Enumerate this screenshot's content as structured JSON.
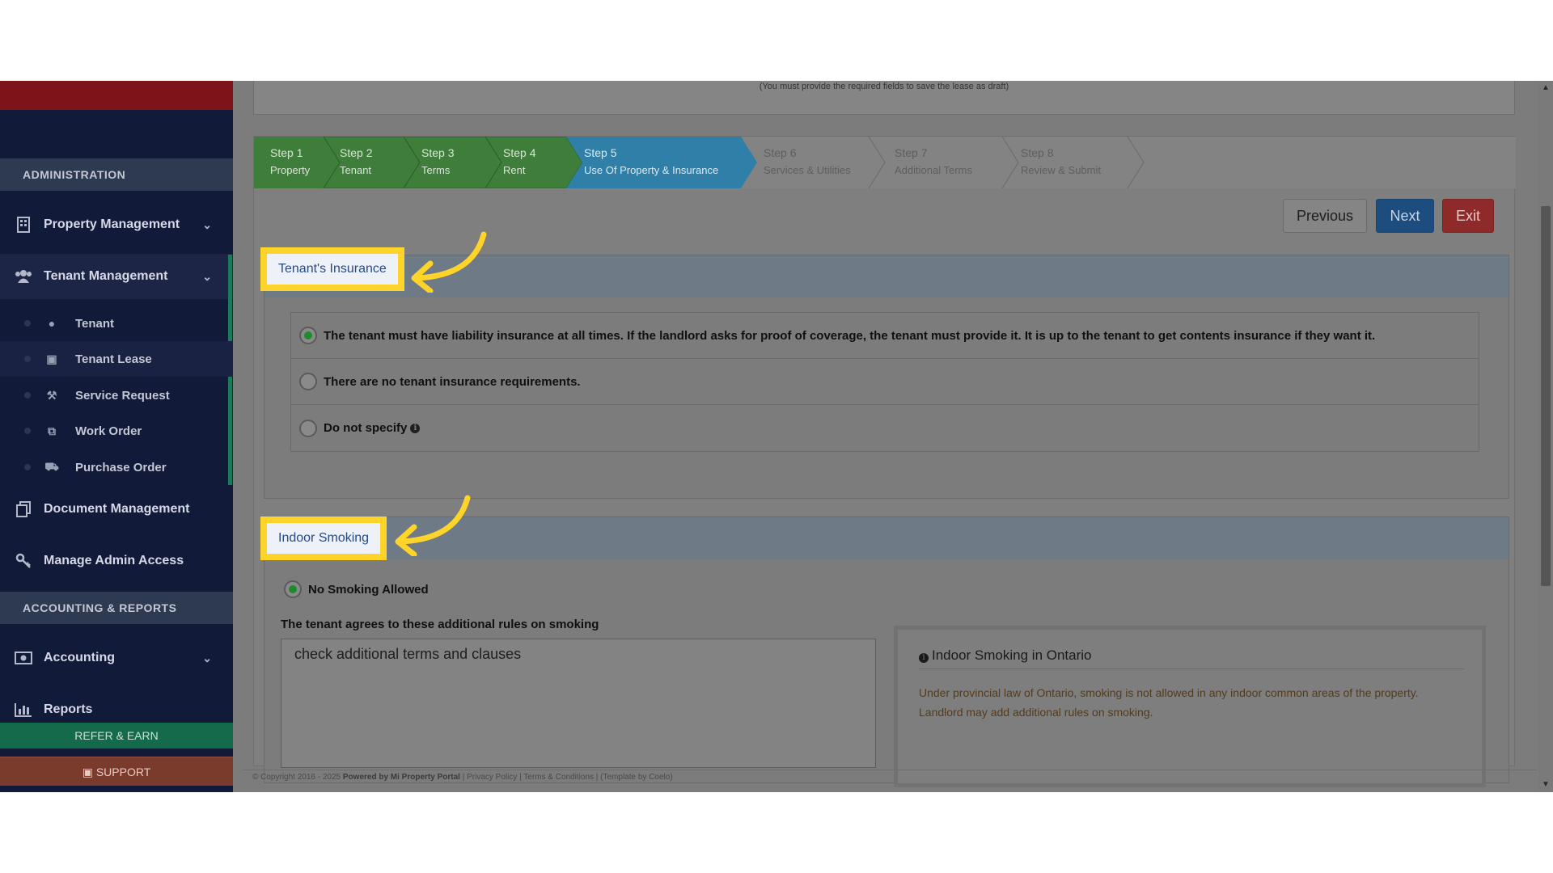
{
  "sidebar": {
    "section_admin": "ADMINISTRATION",
    "section_accounting": "ACCOUNTING & REPORTS",
    "items": {
      "property_management": "Property Management",
      "tenant_management": "Tenant Management",
      "document_management": "Document Management",
      "manage_admin_access": "Manage Admin Access",
      "accounting": "Accounting",
      "reports": "Reports"
    },
    "sub_items": [
      "Tenant",
      "Tenant Lease",
      "Service Request",
      "Work Order",
      "Purchase Order"
    ],
    "refer": "REFER & EARN",
    "support": "SUPPORT"
  },
  "top_note": "(You must provide the required fields to save the lease as draft)",
  "steps": [
    {
      "label": "Step 1",
      "name": "Property"
    },
    {
      "label": "Step 2",
      "name": "Tenant"
    },
    {
      "label": "Step 3",
      "name": "Terms"
    },
    {
      "label": "Step 4",
      "name": "Rent"
    },
    {
      "label": "Step 5",
      "name": "Use Of Property & Insurance"
    },
    {
      "label": "Step 6",
      "name": "Services & Utilities"
    },
    {
      "label": "Step 7",
      "name": "Additional Terms"
    },
    {
      "label": "Step 8",
      "name": "Review & Submit"
    }
  ],
  "buttons": {
    "previous": "Previous",
    "next": "Next",
    "exit": "Exit"
  },
  "insurance": {
    "title": "Tenant's Insurance",
    "options": [
      "The tenant must have liability insurance at all times. If the landlord asks for proof of coverage, the tenant must provide it. It is up to the tenant to get contents insurance if they want it.",
      "There are no tenant insurance requirements.",
      "Do not specify"
    ]
  },
  "smoking": {
    "title": "Indoor Smoking",
    "option": "No Smoking Allowed",
    "rules_label": "The tenant agrees to these additional rules on smoking",
    "rules_value": "check additional terms and clauses",
    "info_title": "Indoor Smoking in Ontario",
    "info_text": "Under provincial law of Ontario, smoking is not allowed in any indoor common areas of the property. Landlord may add additional rules on smoking."
  },
  "footer": {
    "copyright": "© Copyright 2016 - 2025",
    "powered": "Powered by Mi Property Portal",
    "links": "| Privacy Policy | Terms & Conditions |",
    "template": "(Template by Coelo)"
  },
  "colors": {
    "highlight": "#ffd42a",
    "step_done": "#3f7d3a",
    "step_current": "#2f7fa8",
    "next": "#1d4d7e",
    "exit": "#8e2a2a"
  }
}
